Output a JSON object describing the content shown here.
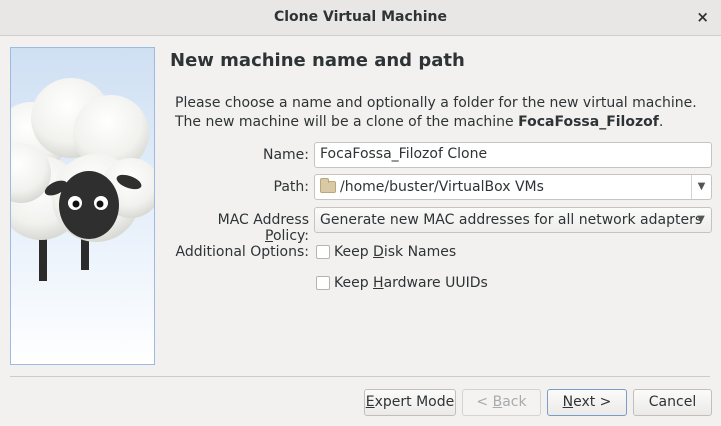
{
  "window": {
    "title": "Clone Virtual Machine",
    "close_glyph": "×"
  },
  "page": {
    "heading": "New machine name and path",
    "description_pre": "Please choose a name and optionally a folder for the new virtual machine. The new machine will be a clone of the machine ",
    "source_vm": "FocaFossa_Filozof",
    "description_post": "."
  },
  "form": {
    "name_label": "Name:",
    "name_value": "FocaFossa_Filozof Clone",
    "path_label": "Path:",
    "path_value": "/home/buster/VirtualBox VMs",
    "mac_label_pre": "MAC Address ",
    "mac_label_mnemonic": "P",
    "mac_label_post": "olicy:",
    "mac_value": "Generate new MAC addresses for all network adapters",
    "options_label": "Additional Options:",
    "keep_disk_pre": "Keep ",
    "keep_disk_mnemonic": "D",
    "keep_disk_post": "isk Names",
    "keep_disk_checked": false,
    "keep_hw_pre": "Keep ",
    "keep_hw_mnemonic": "H",
    "keep_hw_post": "ardware UUIDs",
    "keep_hw_checked": false
  },
  "buttons": {
    "expert_mnemonic": "E",
    "expert_rest": "xpert Mode",
    "back_pre": "< ",
    "back_mnemonic": "B",
    "back_rest": "ack",
    "next_mnemonic": "N",
    "next_rest": "ext >",
    "cancel": "Cancel"
  },
  "icons": {
    "dropdown": "chevron-down-icon",
    "folder": "folder-icon",
    "watermark": "sheep-illustration"
  },
  "colors": {
    "accent_border": "#7a9ccb",
    "image_border": "#9dbbe0"
  }
}
